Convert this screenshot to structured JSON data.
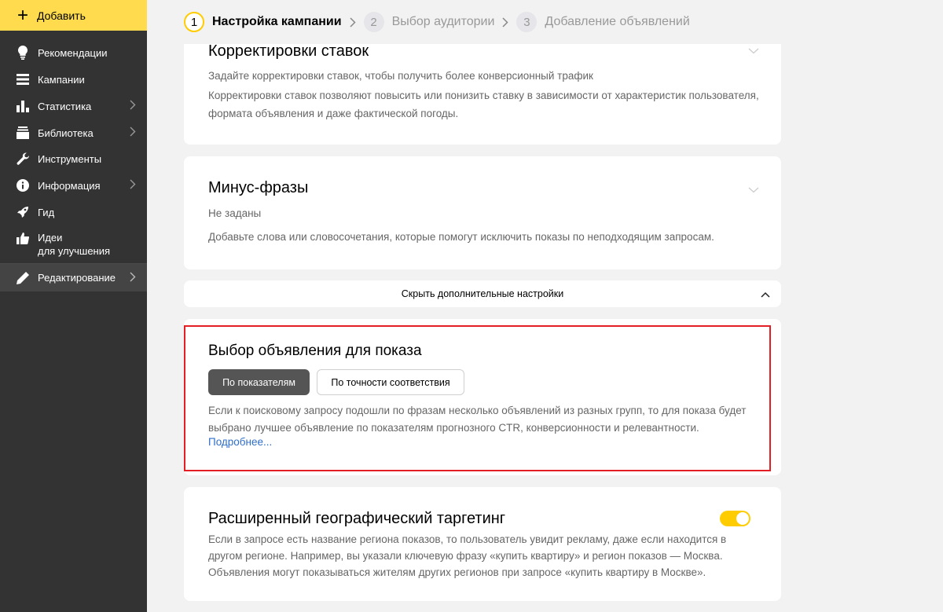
{
  "sidebar": {
    "add_label": "Добавить",
    "items": [
      {
        "label": "Рекомендации"
      },
      {
        "label": "Кампании"
      },
      {
        "label": "Статистика"
      },
      {
        "label": "Библиотека"
      },
      {
        "label": "Инструменты"
      },
      {
        "label": "Информация"
      },
      {
        "label": "Гид"
      },
      {
        "label_line1": "Идеи",
        "label_line2": "для улучшения"
      },
      {
        "label": "Редактирование"
      }
    ]
  },
  "stepper": {
    "steps": [
      {
        "num": "1",
        "label": "Настройка кампании"
      },
      {
        "num": "2",
        "label": "Выбор аудитории"
      },
      {
        "num": "3",
        "label": "Добавление объявлений"
      }
    ]
  },
  "bid_adjustments": {
    "title": "Корректировки ставок",
    "subtitle": "Задайте корректировки ставок, чтобы получить более конверсионный трафик",
    "description": "Корректировки ставок позволяют повысить или понизить ставку в зависимости от характеристик пользователя, формата объявления и даже фактической погоды."
  },
  "negative_phrases": {
    "title": "Минус-фразы",
    "value": "Не заданы",
    "description": "Добавьте слова или словосочетания, которые помогут исключить показы по неподходящим запросам."
  },
  "hide_settings_label": "Скрыть дополнительные настройки",
  "ad_selection": {
    "title": "Выбор объявления для показа",
    "option_on": "По показателям",
    "option_off": "По точности соответствия",
    "description": "Если к поисковому запросу подошли по фразам несколько объявлений из разных групп, то для показа будет выбрано лучшее объявление по показателям прогнозного CTR, конверсионности и релевантности.",
    "more_link": "Подробнее..."
  },
  "geo_targeting": {
    "title": "Расширенный географический таргетинг",
    "description": "Если в запросе есть название региона показов, то пользователь увидит рекламу, даже если находится в другом регионе. Например, вы указали ключевую фразу «купить квартиру» и регион показов — Москва. Объявления могут показываться жителям других регионов при запросе «купить квартиру в Москве».",
    "enabled": true
  },
  "colors": {
    "accent_yellow": "#ffdb4d",
    "sidebar_bg": "#333333",
    "highlight_red": "#e31e24",
    "link_blue": "#2f6ec9"
  }
}
